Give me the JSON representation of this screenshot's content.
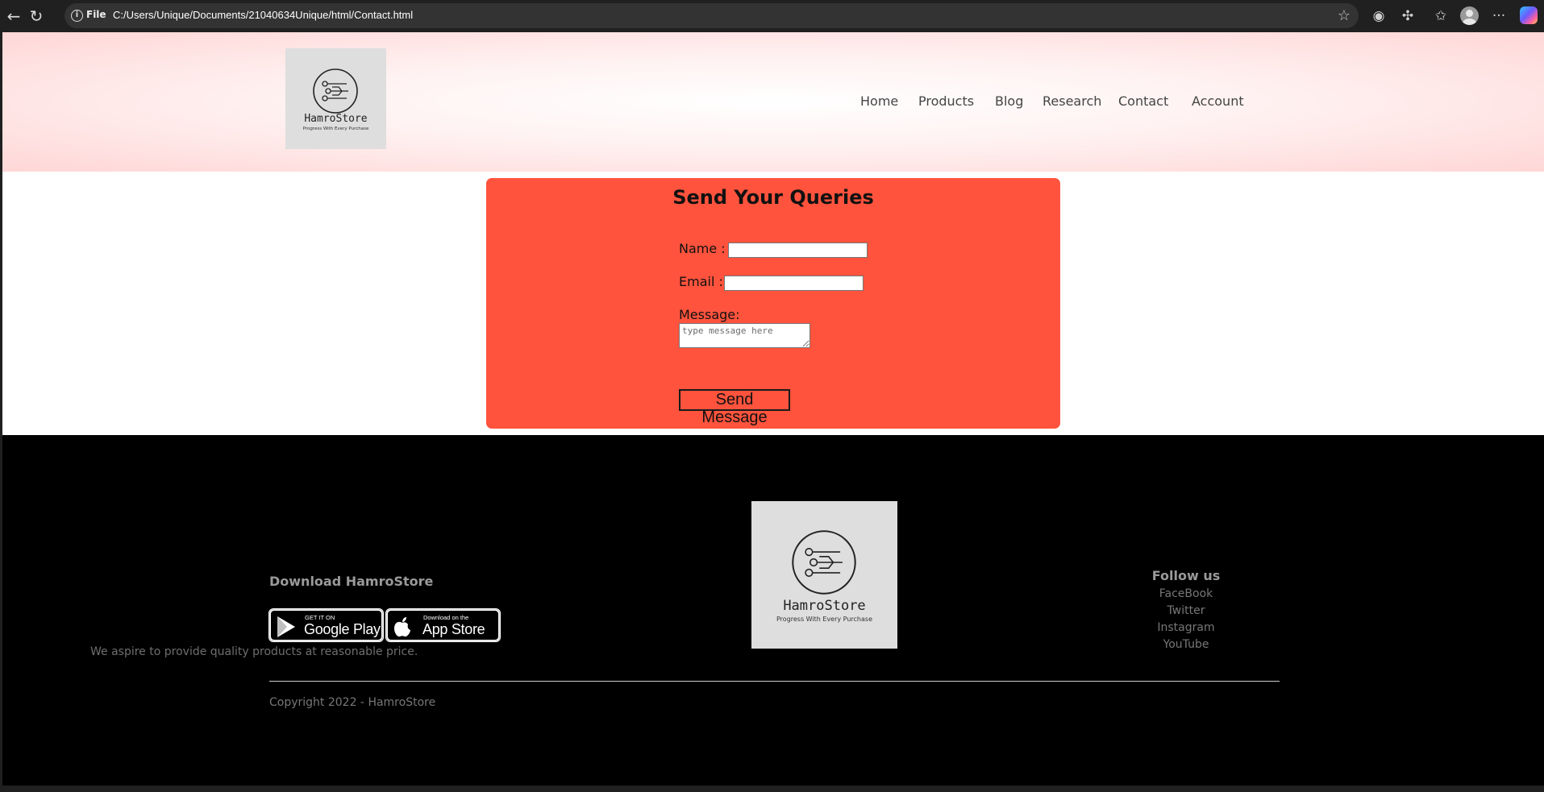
{
  "browser": {
    "file_label": "File",
    "url": "C:/Users/Unique/Documents/21040634Unique/html/Contact.html"
  },
  "header": {
    "logo_name": "HamroStore",
    "logo_tagline": "Progress With Every Purchase",
    "nav": [
      "Home",
      "Products",
      "Blog",
      "Research",
      "Contact",
      "Account"
    ]
  },
  "form": {
    "title": "Send Your Queries",
    "name_label": "Name :",
    "name_value": "",
    "email_label": "Email :",
    "email_value": "",
    "message_label": "Message:",
    "message_placeholder": "type message here",
    "submit_label": "Send Message"
  },
  "footer": {
    "download_title": "Download HamroStore",
    "google_small": "GET IT ON",
    "google_big": "Google Play",
    "apple_small": "Download on the",
    "apple_big": "App Store",
    "logo_name": "HamroStore",
    "logo_tagline": "Progress With Every Purchase",
    "tagline": "We aspire to provide quality products at reasonable price.",
    "follow_title": "Follow us",
    "social": [
      "FaceBook",
      "Twitter",
      "Instagram",
      "YouTube"
    ],
    "copyright": "Copyright 2022 - HamroStore"
  },
  "colors": {
    "card": "#ff533d",
    "footer_bg": "#000000",
    "header_gradient_edge": "#ffd6d6"
  },
  "icons": {
    "back": "arrow-left-icon",
    "reload": "reload-icon",
    "info": "info-icon",
    "favorite": "star-icon",
    "extensions": "puzzle-icon",
    "favorites_bar": "favorites-icon",
    "profile": "avatar-icon",
    "menu": "more-icon",
    "copilot": "copilot-icon"
  }
}
